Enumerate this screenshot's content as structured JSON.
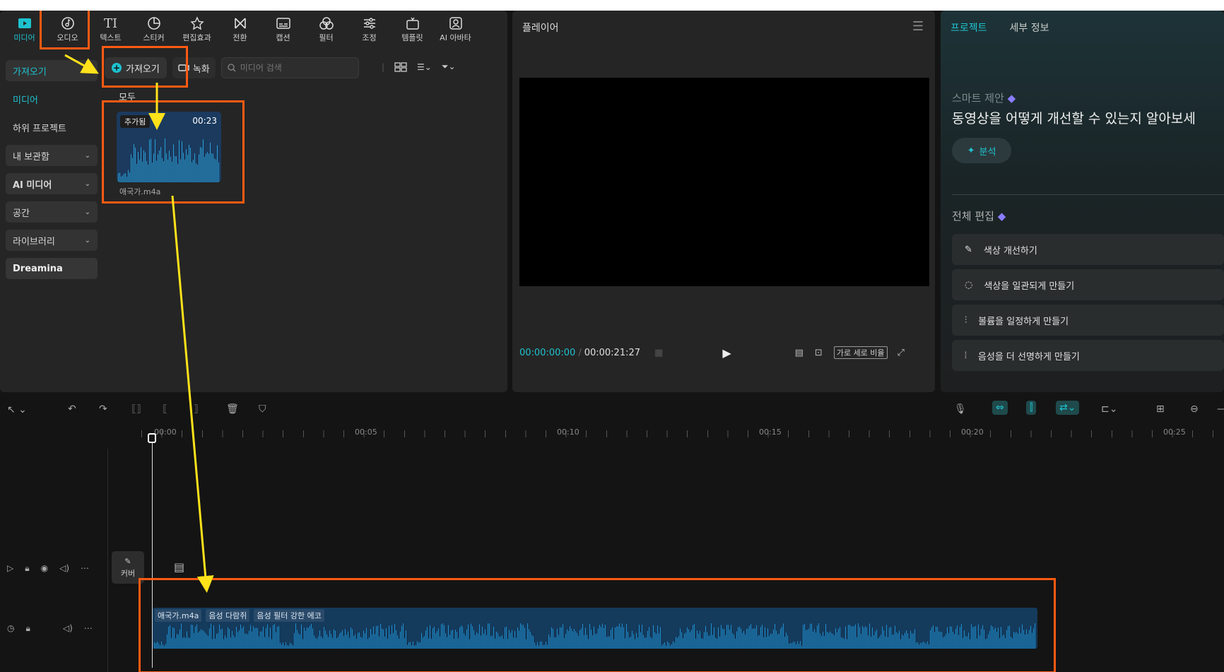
{
  "top_tools": [
    {
      "label": "미디어",
      "icon": "media-icon"
    },
    {
      "label": "오디오",
      "icon": "audio-icon"
    },
    {
      "label": "텍스트",
      "icon": "text-icon"
    },
    {
      "label": "스티커",
      "icon": "sticker-icon"
    },
    {
      "label": "편집효과",
      "icon": "effects-icon"
    },
    {
      "label": "전환",
      "icon": "transition-icon"
    },
    {
      "label": "캡션",
      "icon": "caption-icon"
    },
    {
      "label": "필터",
      "icon": "filter-icon"
    },
    {
      "label": "조정",
      "icon": "adjust-icon"
    },
    {
      "label": "템플릿",
      "icon": "template-icon"
    },
    {
      "label": "AI 아바타",
      "icon": "ai-avatar-icon"
    }
  ],
  "sidebar": {
    "items": [
      {
        "label": "가져오기"
      },
      {
        "label": "미디어"
      },
      {
        "label": "하위 프로젝트"
      },
      {
        "label": "내 보관함"
      },
      {
        "label": "AI 미디어"
      },
      {
        "label": "공간"
      },
      {
        "label": "라이브러리"
      },
      {
        "label": "Dreamina"
      }
    ]
  },
  "media": {
    "import_label": "가져오기",
    "record_label": "녹화",
    "search_placeholder": "미디어 검색",
    "filter_all": "모두",
    "item": {
      "badge": "추가됨",
      "duration": "00:23",
      "name": "애국가.m4a"
    }
  },
  "player": {
    "title": "플레이어",
    "current_time": "00:00:00:00",
    "separator": "/",
    "total_time": "00:00:21:27",
    "ratio_label": "가로 세로 비율"
  },
  "details": {
    "tabs": [
      "프로젝트",
      "세부 정보"
    ],
    "smart_label": "스마트 제안",
    "smart_text": "동영상을 어떻게 개선할 수 있는지 알아보세",
    "analyze_label": "분석",
    "full_edit_label": "전체 편집",
    "edit_items": [
      {
        "label": "색상 개선하기",
        "icon": "magic-wand-icon"
      },
      {
        "label": "색상을 일관되게 만들기",
        "icon": "color-sync-icon"
      },
      {
        "label": "볼륨을 일정하게 만들기",
        "icon": "equalizer-icon"
      },
      {
        "label": "음성을 더 선명하게 만들기",
        "icon": "voice-wave-icon"
      }
    ]
  },
  "timeline": {
    "ruler": [
      "00:00",
      "00:05",
      "00:10",
      "00:15",
      "00:20",
      "00:25"
    ],
    "cover_label": "커버",
    "clip": {
      "tags": [
        "애국가.m4a",
        "음성 다람쥐",
        "음성 필터 강한 에코"
      ]
    }
  },
  "colors": {
    "accent": "#1ec2cf",
    "highlight": "#ff5a12",
    "arrow": "#ffe21a",
    "clip": "#143a5c"
  }
}
